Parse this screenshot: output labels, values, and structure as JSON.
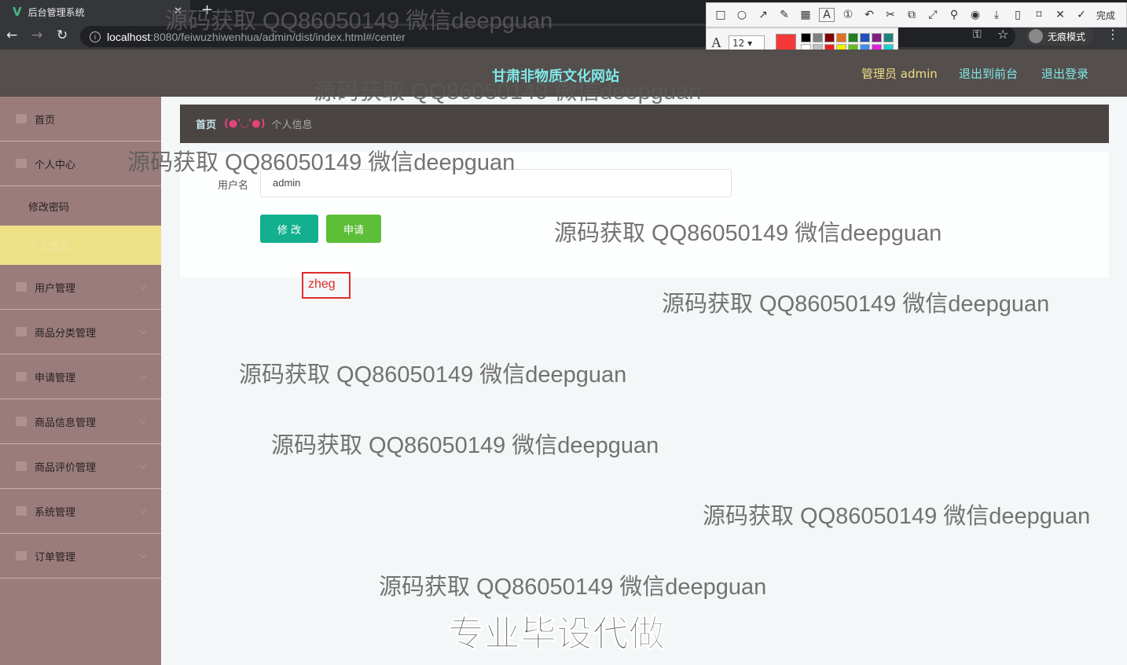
{
  "browser": {
    "tab_title": "后台管理系统",
    "tab_close": "✕",
    "new_tab": "+",
    "url_host": "localhost",
    "url_path": ":8080/feiwuzhiwenhua/admin/dist/index.html#/center",
    "incognito_label": "无痕模式"
  },
  "snip_toolbar": {
    "done_label": "完成",
    "font_size": "12",
    "current_color": "#f53838",
    "palette": [
      "#000000",
      "#808080",
      "#800000",
      "#e07020",
      "#208020",
      "#2050c0",
      "#802080",
      "#208080",
      "#ffffff",
      "#c0c0c0",
      "#f02020",
      "#f0f000",
      "#60c020",
      "#4090f0",
      "#e020e0",
      "#20d0d0"
    ]
  },
  "header": {
    "site_title": "甘肃非物质文化网站",
    "admin_label": "管理员 admin",
    "to_front": "退出到前台",
    "logout": "退出登录"
  },
  "sidebar": {
    "home": "首页",
    "personal_center": "个人中心",
    "change_password": "修改密码",
    "personal_info": "个人信息",
    "items": [
      "用户管理",
      "商品分类管理",
      "申请管理",
      "商品信息管理",
      "商品评价管理",
      "系统管理",
      "订单管理"
    ]
  },
  "breadcrumb": {
    "home": "首页",
    "face": "(●'◡'●)",
    "current": "个人信息"
  },
  "form": {
    "username_label": "用户名",
    "username_value": "admin",
    "edit_button": "修 改",
    "apply_button": "申请"
  },
  "annotation_text": "zheg",
  "watermark": "源码获取 QQ86050149 微信deepguan",
  "watermark_big": "专业毕设代做"
}
